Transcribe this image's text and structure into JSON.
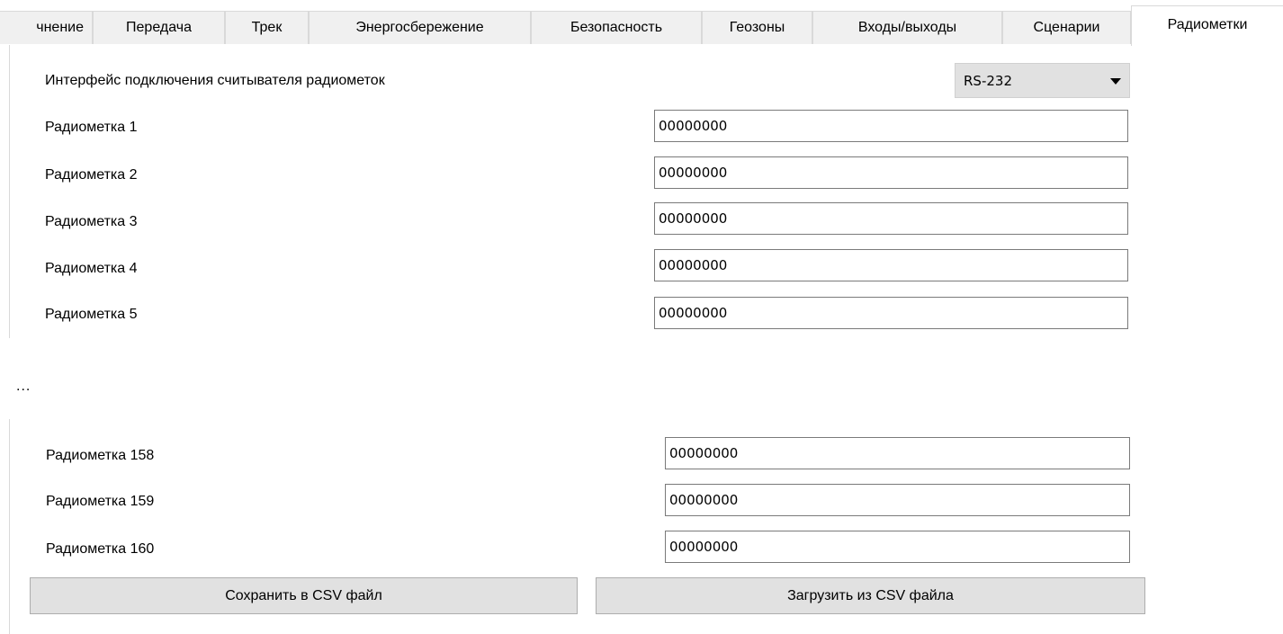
{
  "tabs": [
    {
      "label": "чнение",
      "active": false
    },
    {
      "label": "Передача",
      "active": false
    },
    {
      "label": "Трек",
      "active": false
    },
    {
      "label": "Энергосбережение",
      "active": false
    },
    {
      "label": "Безопасность",
      "active": false
    },
    {
      "label": "Геозоны",
      "active": false
    },
    {
      "label": "Входы/выходы",
      "active": false
    },
    {
      "label": "Сценарии",
      "active": false
    },
    {
      "label": "Радиометки",
      "active": true
    }
  ],
  "interface": {
    "label": "Интерфейс подключения считывателя радиометок",
    "value": "RS-232"
  },
  "tags_top": [
    {
      "label": "Радиометка 1",
      "value": "00000000"
    },
    {
      "label": "Радиометка 2",
      "value": "00000000"
    },
    {
      "label": "Радиометка 3",
      "value": "00000000"
    },
    {
      "label": "Радиометка 4",
      "value": "00000000"
    },
    {
      "label": "Радиометка 5",
      "value": "00000000"
    }
  ],
  "ellipsis": "...",
  "tags_bottom": [
    {
      "label": "Радиометка 158",
      "value": "00000000"
    },
    {
      "label": "Радиометка 159",
      "value": "00000000"
    },
    {
      "label": "Радиометка 160",
      "value": "00000000"
    }
  ],
  "buttons": {
    "save": "Сохранить в CSV файл",
    "load": "Загрузить из CSV файла"
  }
}
